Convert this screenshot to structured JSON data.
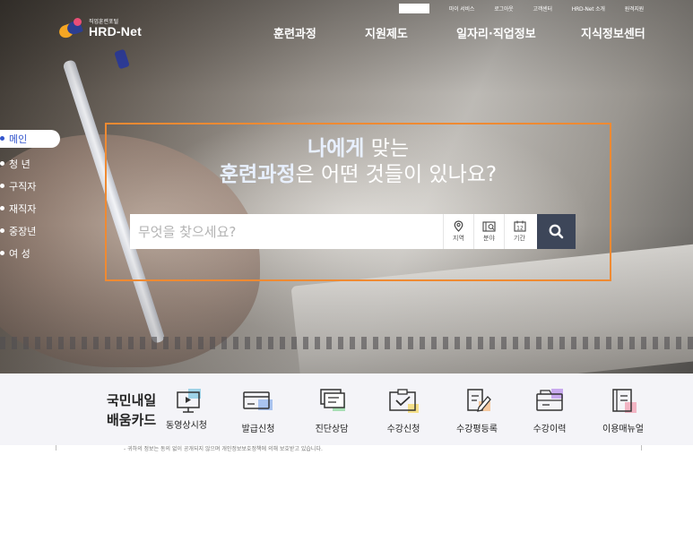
{
  "util_bar": [
    "마이 서비스",
    "로그아웃",
    "고객센터",
    "HRD-Net 소개",
    "원격지원"
  ],
  "logo": {
    "sub": "직업훈련포털",
    "main": "HRD-Net"
  },
  "gnb": [
    "훈련과정",
    "지원제도",
    "일자리·직업정보",
    "지식정보센터"
  ],
  "side_nav": [
    {
      "label": "메인",
      "active": true
    },
    {
      "label": "청 년",
      "active": false
    },
    {
      "label": "구직자",
      "active": false
    },
    {
      "label": "재직자",
      "active": false
    },
    {
      "label": "중장년",
      "active": false
    },
    {
      "label": "여 성",
      "active": false
    }
  ],
  "headline": {
    "line1_bold": "나에게",
    "line1_rest": " 맞는",
    "line2_bold": "훈련과정",
    "line2_rest": "은 어떤 것들이 있나요?"
  },
  "search": {
    "placeholder": "무엇을 찾으세요?",
    "filters": [
      {
        "label": "지역",
        "icon": "location-pin-icon"
      },
      {
        "label": "분야",
        "icon": "field-category-icon"
      },
      {
        "label": "기간",
        "icon": "calendar-icon"
      }
    ],
    "calendar_day": "12",
    "submit_icon": "search-icon"
  },
  "card": {
    "title_line1": "국민내일",
    "title_line2": "배움카드",
    "services": [
      {
        "label": "동영상시청",
        "icon": "video-monitor-icon"
      },
      {
        "label": "발급신청",
        "icon": "card-issue-icon"
      },
      {
        "label": "진단상담",
        "icon": "consult-icon"
      },
      {
        "label": "수강신청",
        "icon": "enroll-check-icon"
      },
      {
        "label": "수강평등록",
        "icon": "review-write-icon"
      },
      {
        "label": "수강이력",
        "icon": "history-folder-icon"
      },
      {
        "label": "이용매뉴얼",
        "icon": "manual-book-icon"
      }
    ]
  },
  "below_text": "- 귀하의 정보는 동의 없이 공개되지 않으며 개인정보보호정책에 의해 보호받고 있습니다.",
  "colors": {
    "accent_border": "#ef8a32",
    "search_button": "#3d4659",
    "active_side": "#3355cc"
  }
}
